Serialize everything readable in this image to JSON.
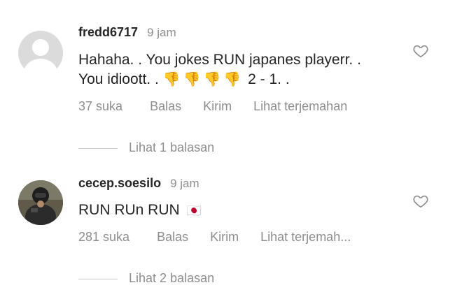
{
  "comments": [
    {
      "username": "fredd6717",
      "time": "9 jam",
      "text_line1": "Hahaha. . You jokes RUN japanes playerr. .",
      "text_line2_prefix": "You idioott. .",
      "emoji": "👎",
      "emoji_count": 4,
      "text_line2_suffix": "2 - 1. .",
      "likes": "37 suka",
      "reply_label": "Balas",
      "send_label": "Kirim",
      "translate_label": "Lihat terjemahan",
      "view_replies": "Lihat 1 balasan",
      "avatar_icon": "default-user-icon",
      "like_icon": "heart-outline-icon"
    },
    {
      "username": "cecep.soesilo",
      "time": "9 jam",
      "text": "RUN RUn RUN",
      "flag_emoji": "🇯🇵",
      "likes": "281 suka",
      "reply_label": "Balas",
      "send_label": "Kirim",
      "translate_label": "Lihat terjemah...",
      "view_replies": "Lihat 2 balasan",
      "avatar_icon": "photo-avatar",
      "like_icon": "heart-outline-icon"
    }
  ],
  "colors": {
    "text_primary": "#262626",
    "text_secondary": "#8e8e8e",
    "divider": "#c7c7c7",
    "avatar_placeholder": "#dbdbdb"
  }
}
